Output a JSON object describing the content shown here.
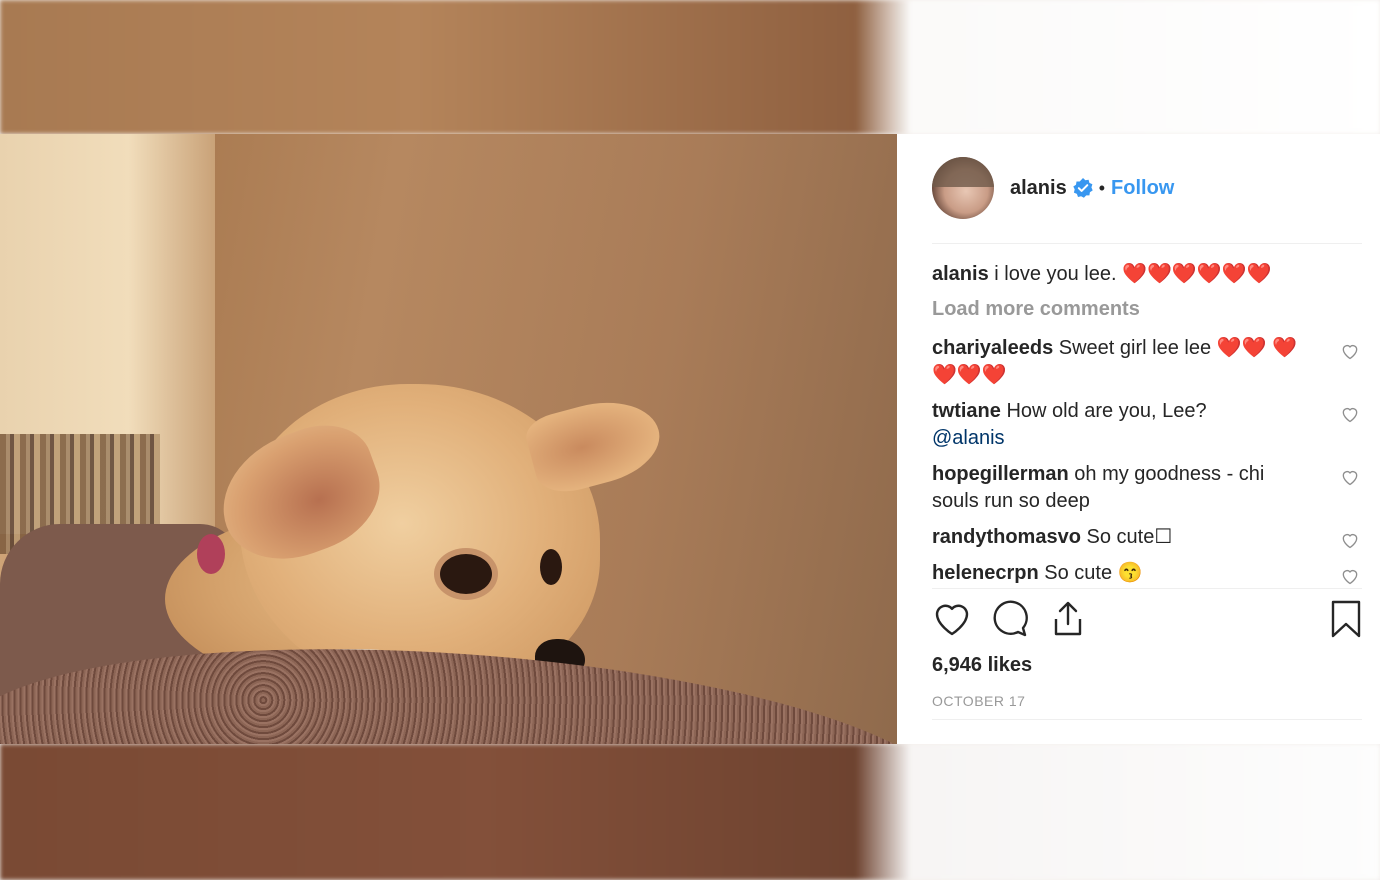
{
  "post": {
    "username": "alanis",
    "follow_label": "Follow",
    "separator": "•",
    "caption": {
      "user": "alanis",
      "text": " i love you lee. ❤️❤️❤️❤️❤️❤️"
    },
    "load_more_label": "Load more comments",
    "comments": [
      {
        "user": "chariyaleeds",
        "text": " Sweet girl lee lee ❤️❤️ ❤️❤️❤️❤️"
      },
      {
        "user": "twtiane",
        "text": " How old are you, Lee? ",
        "mention": "@alanis"
      },
      {
        "user": "hopegillerman",
        "text": " oh my goodness - chi souls run so deep"
      },
      {
        "user": "randythomasvo",
        "text": " So cute☐"
      },
      {
        "user": "helenecrpn",
        "text": " So cute 😙"
      }
    ],
    "likes": "6,946 likes",
    "date": "OCTOBER 17"
  },
  "colors": {
    "accent": "#3897f0",
    "text": "#262626",
    "muted": "#999999",
    "verified": "#3897f0"
  },
  "icons": [
    "verified-badge-icon",
    "heart-icon",
    "comment-icon",
    "share-icon",
    "bookmark-icon",
    "comment-like-heart-icon"
  ]
}
